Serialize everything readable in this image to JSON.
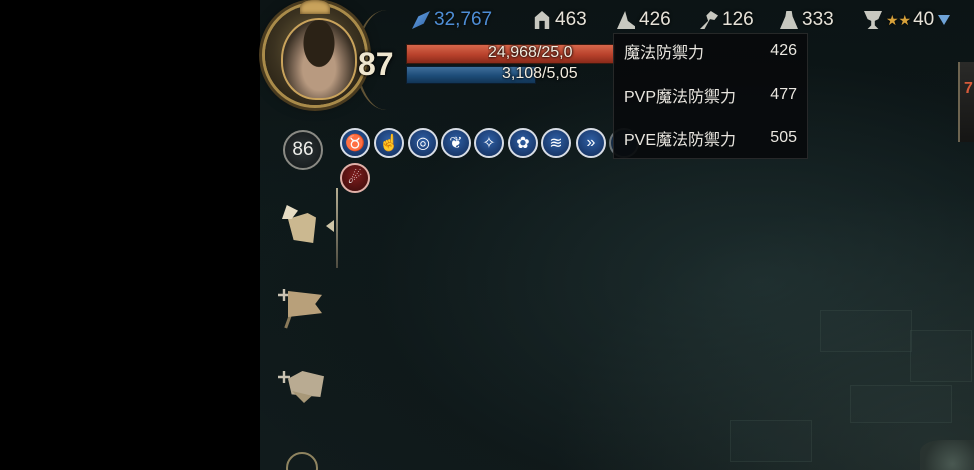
{
  "hud": {
    "level": "87",
    "hp_text": "24,968/25,0",
    "mp_text": "3,108/5,05",
    "hp_ratio": 0.99,
    "mp_ratio": 0.61,
    "colors": {
      "hp": "#b8412b",
      "mp": "#1d4c78",
      "power": "#4e8ed6",
      "stars": "#d7a13a"
    }
  },
  "resources": {
    "combat_power": {
      "icon": "quill-icon",
      "value": "32,767"
    },
    "physical_defense": {
      "icon": "helmet-icon",
      "value": "463"
    },
    "magic_defense": {
      "icon": "wizard-hat-icon",
      "value": "426"
    },
    "key_stat": {
      "icon": "key-icon",
      "value": "126"
    },
    "person_stat": {
      "icon": "person-icon",
      "value": "333"
    },
    "trophy": {
      "icon": "trophy-icon",
      "stars": "★★",
      "value": "40"
    }
  },
  "tooltip": {
    "rows": [
      {
        "label": "魔法防禦力",
        "value": "426"
      },
      {
        "label": "PVP魔法防禦力",
        "value": "477"
      },
      {
        "label": "PVE魔法防禦力",
        "value": "505"
      }
    ]
  },
  "buffs": {
    "level_badge": "86",
    "items": [
      {
        "icon": "bull-skull-icon",
        "glyph": "♉"
      },
      {
        "icon": "hand-icon",
        "glyph": "☝"
      },
      {
        "icon": "target-ring-icon",
        "glyph": "◎"
      },
      {
        "icon": "leaf-shield-icon",
        "glyph": "❦"
      },
      {
        "icon": "swirl-icon",
        "glyph": "✧"
      },
      {
        "icon": "flower-icon",
        "glyph": "✿"
      },
      {
        "icon": "wave-icon",
        "glyph": "≋"
      },
      {
        "icon": "double-arrow-icon",
        "glyph": "»"
      },
      {
        "icon": "faded-buff-icon",
        "glyph": ""
      }
    ],
    "debuff": {
      "icon": "flame-figure-icon",
      "glyph": "☄"
    }
  },
  "menu": {
    "items": [
      {
        "name": "quest-menu",
        "icon": "scroll-quill-icon"
      },
      {
        "name": "guild-menu",
        "icon": "flag-icon"
      },
      {
        "name": "party-menu",
        "icon": "party-icon"
      },
      {
        "name": "more-menu",
        "icon": "compass-icon"
      }
    ]
  },
  "right_widget": {
    "text": "7"
  }
}
